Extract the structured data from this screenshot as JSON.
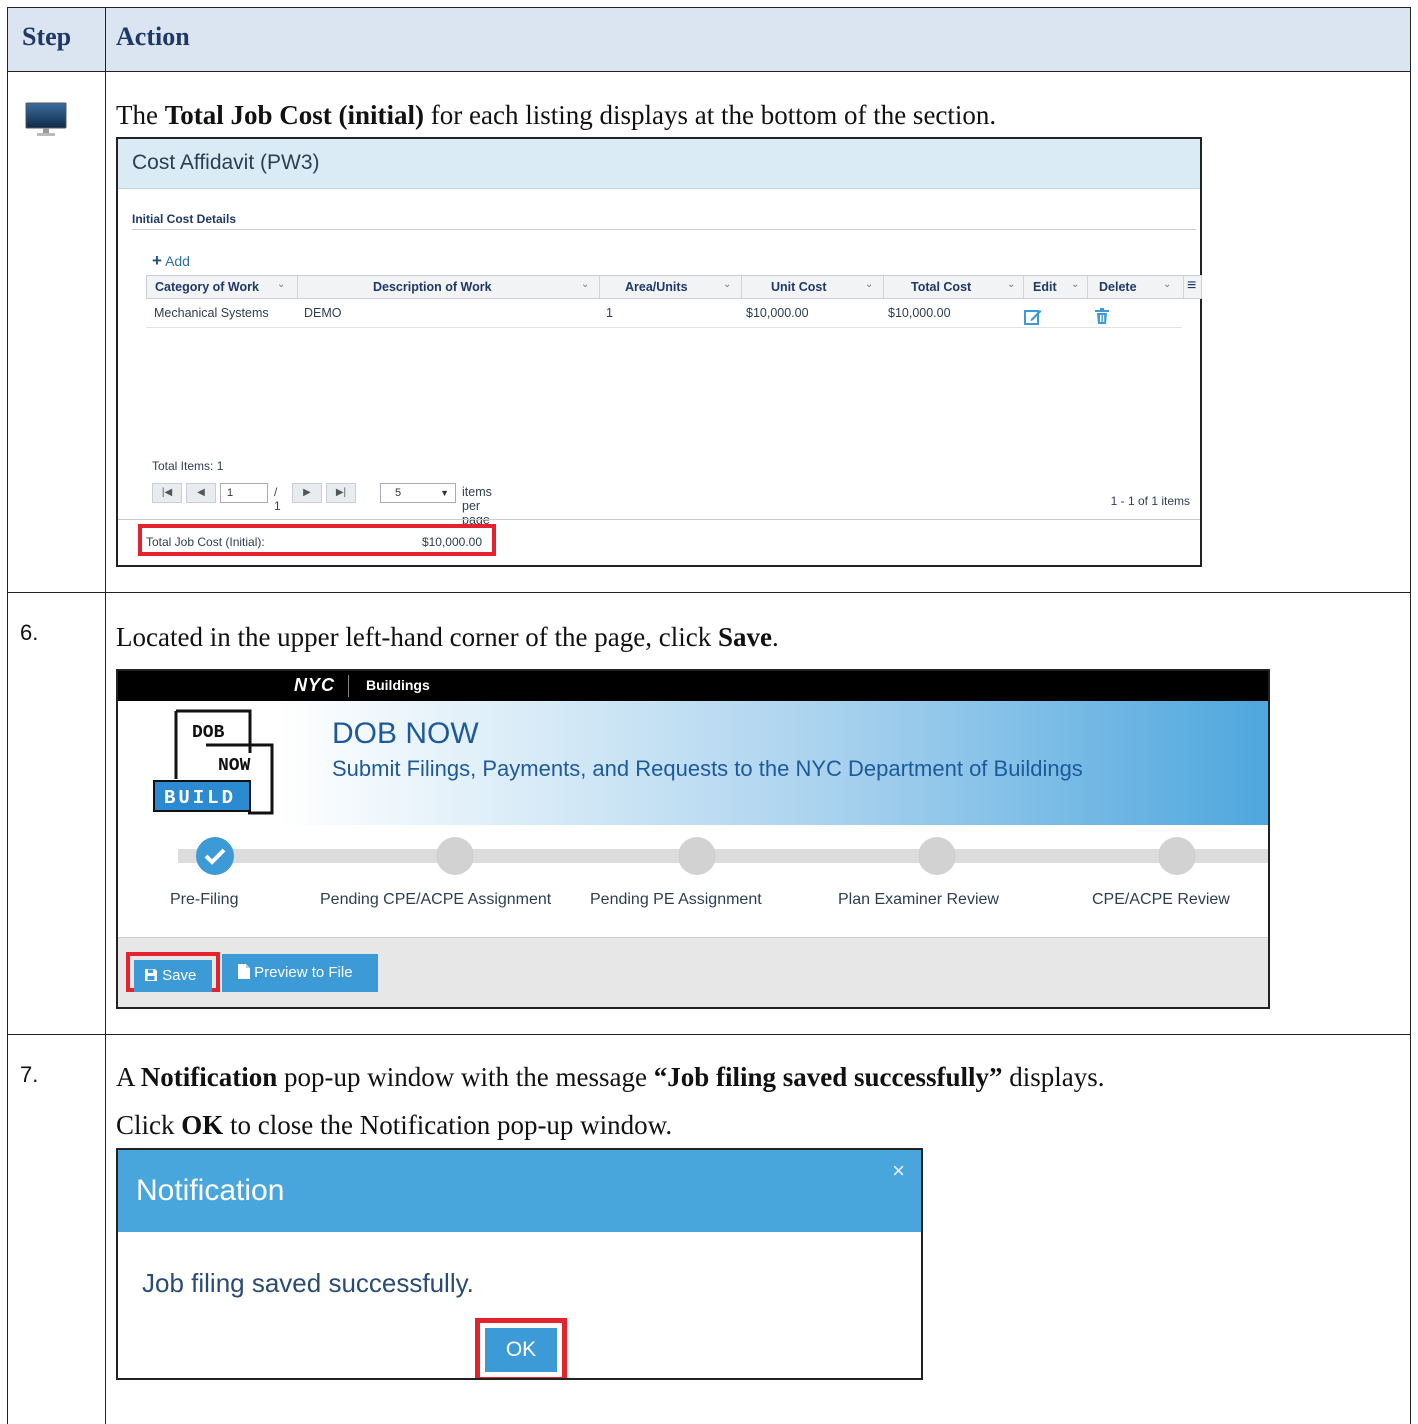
{
  "header": {
    "step_label": "Step",
    "action_label": "Action"
  },
  "rows": [
    {
      "step": "",
      "instruction": {
        "pre": "The ",
        "bold": "Total Job Cost (initial)",
        "post": " for each listing displays at the bottom of the section."
      }
    },
    {
      "step": "6.",
      "instruction": {
        "pre": "Located in the upper left-hand corner of the page, click ",
        "bold": "Save",
        "post": "."
      }
    },
    {
      "step": "7.",
      "instruction": {
        "pre": "A ",
        "bold": "Notification",
        "mid": " pop-up window with the message ",
        "bold2": "“Job filing saved successfully”",
        "post": " displays."
      },
      "instruction2": {
        "pre": "Click ",
        "bold": "OK",
        "post": " to close the Notification pop-up window."
      }
    }
  ],
  "cost_affidavit": {
    "title": "Cost Affidavit (PW3)",
    "section": "Initial Cost Details",
    "add_label": "Add",
    "columns": [
      "Category of Work",
      "Description of Work",
      "Area/Units",
      "Unit Cost",
      "Total Cost",
      "Edit",
      "Delete"
    ],
    "row": {
      "category": "Mechanical Systems",
      "description": "DEMO",
      "area_units": "1",
      "unit_cost": "$10,000.00",
      "total_cost": "$10,000.00"
    },
    "total_items": "Total Items: 1",
    "pager": {
      "page": "1",
      "of_pages": "/ 1",
      "per_page": "5",
      "items_per_page_label": "items per page",
      "range": "1 - 1 of 1 items"
    },
    "total_job_cost_label": "Total Job Cost (Initial):",
    "total_job_cost_value": "$10,000.00"
  },
  "dob": {
    "nyc": "NYC",
    "buildings": "Buildings",
    "logo_words": [
      "DOB",
      "NOW",
      "BUILD"
    ],
    "title": "DOB NOW",
    "subtitle": "Submit Filings, Payments, and Requests to the NYC Department of Buildings",
    "stages": [
      "Pre-Filing",
      "Pending CPE/ACPE Assignment",
      "Pending PE Assignment",
      "Plan Examiner Review",
      "CPE/ACPE Review"
    ],
    "save_label": "Save",
    "preview_label": "Preview to File"
  },
  "notification": {
    "title": "Notification",
    "close": "×",
    "message": "Job filing saved successfully.",
    "ok_label": "OK"
  },
  "colors": {
    "accent_blue": "#3c9ad7",
    "highlight_red": "#e5232e",
    "header_bg": "#dbe5f1",
    "heading_text": "#1f3864"
  }
}
